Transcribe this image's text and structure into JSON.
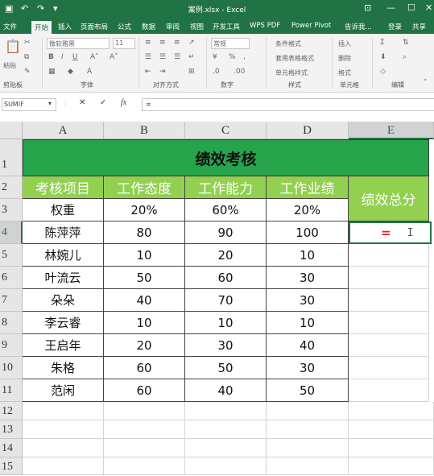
{
  "window": {
    "title": "案例.xlsx - Excel"
  },
  "ribbon_tabs": [
    "文件",
    "开始",
    "插入",
    "页面布局",
    "公式",
    "数据",
    "审阅",
    "视图",
    "开发工具",
    "WPS PDF",
    "Power Pivot",
    "告诉我...",
    "登录",
    "共享"
  ],
  "ribbon": {
    "font_name": "微软雅黑",
    "font_size": "11",
    "number_format": "常规",
    "styles": [
      "条件格式",
      "套用表格格式",
      "单元格样式"
    ],
    "cells": [
      "插入",
      "删除",
      "格式"
    ],
    "groups": [
      "剪贴板",
      "字体",
      "对齐方式",
      "数字",
      "样式",
      "单元格",
      "编辑"
    ],
    "paste_label": "粘贴"
  },
  "formula_bar": {
    "name_box": "SUMIF",
    "formula": "="
  },
  "columns": [
    "A",
    "B",
    "C",
    "D",
    "E"
  ],
  "selected_column": "E",
  "rows": [
    "1",
    "2",
    "3",
    "4",
    "5",
    "6",
    "7",
    "8",
    "9",
    "10",
    "11",
    "12",
    "13",
    "14",
    "15"
  ],
  "selected_row": "4",
  "sheet": {
    "title": "绩效考核",
    "headers": [
      "考核项目",
      "工作态度",
      "工作能力",
      "工作业绩"
    ],
    "score_header": "绩效总分",
    "weights": [
      "权重",
      "20%",
      "60%",
      "20%"
    ],
    "data": [
      [
        "陈萍萍",
        "80",
        "90",
        "100"
      ],
      [
        "林婉儿",
        "10",
        "20",
        "10"
      ],
      [
        "叶流云",
        "50",
        "60",
        "30"
      ],
      [
        "朵朵",
        "40",
        "70",
        "30"
      ],
      [
        "李云睿",
        "10",
        "10",
        "10"
      ],
      [
        "王启年",
        "20",
        "30",
        "40"
      ],
      [
        "朱格",
        "60",
        "50",
        "30"
      ],
      [
        "范闲",
        "60",
        "40",
        "50"
      ]
    ],
    "active_cell_value": "="
  }
}
